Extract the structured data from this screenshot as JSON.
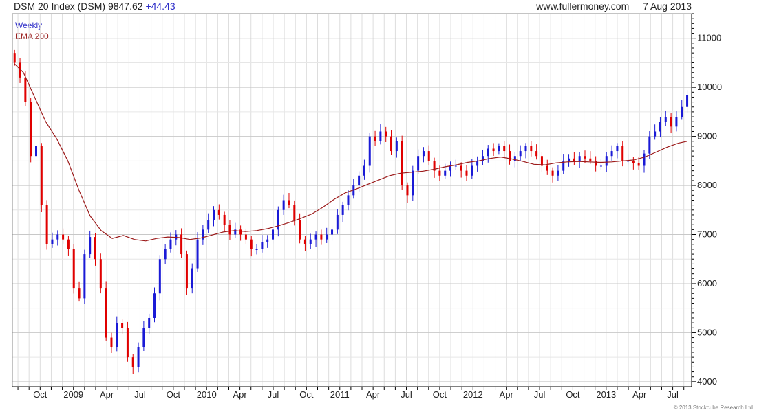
{
  "header": {
    "symbol": "DSM 20 Index (DSM)",
    "last": "9847.62",
    "change": "+44.43",
    "site": "www.fullermoney.com",
    "date": "7 Aug 2013"
  },
  "legend": {
    "weekly": "Weekly",
    "ema": "EMA 200"
  },
  "copyright": "© 2013 Stockcube Research Ltd",
  "colors": {
    "up": "#1a1ad6",
    "down": "#e00000",
    "ema": "#9c1a1a",
    "grid": "#dddddd",
    "axis": "#000000"
  },
  "chart_data": {
    "type": "candlestick",
    "interval": "Weekly",
    "ylim": [
      3900,
      11500
    ],
    "y_ticks": [
      4000,
      5000,
      6000,
      7000,
      8000,
      9000,
      10000,
      11000
    ],
    "x_tick_labels": [
      "Oct",
      "2009",
      "Apr",
      "Jul",
      "Oct",
      "2010",
      "Apr",
      "Jul",
      "Oct",
      "2011",
      "Apr",
      "Jul",
      "Oct",
      "2012",
      "Apr",
      "Jul",
      "Oct",
      "2013",
      "Apr",
      "Jul"
    ],
    "x_tick_months": [
      3,
      6,
      9,
      12,
      15,
      18,
      21,
      24,
      27,
      30,
      33,
      36,
      39,
      42,
      45,
      48,
      51,
      54,
      57,
      60
    ],
    "x_range_months": [
      0.5,
      61.7
    ],
    "close_series_weekly": [
      10500,
      10200,
      9700,
      8600,
      8800,
      7600,
      6800,
      6900,
      7000,
      6900,
      6700,
      5900,
      5700,
      6600,
      6950,
      6500,
      5900,
      4900,
      4700,
      5200,
      5100,
      4500,
      4300,
      4700,
      5100,
      5300,
      5800,
      6500,
      6700,
      6900,
      7000,
      6600,
      5900,
      6300,
      6900,
      7100,
      7300,
      7500,
      7400,
      7200,
      7000,
      7100,
      7000,
      6900,
      6700,
      6700,
      6850,
      6900,
      7100,
      7500,
      7700,
      7600,
      7300,
      6900,
      6800,
      6900,
      7000,
      6900,
      7000,
      7100,
      7400,
      7600,
      7800,
      8000,
      8200,
      8400,
      9000,
      8900,
      9100,
      9000,
      8700,
      8900,
      8000,
      7800,
      8300,
      8600,
      8700,
      8500,
      8300,
      8200,
      8300,
      8400,
      8400,
      8300,
      8200,
      8400,
      8500,
      8600,
      8750,
      8700,
      8800,
      8700,
      8500,
      8600,
      8700,
      8800,
      8700,
      8600,
      8400,
      8300,
      8200,
      8300,
      8500,
      8550,
      8500,
      8600,
      8550,
      8500,
      8400,
      8400,
      8600,
      8700,
      8800,
      8500,
      8500,
      8450,
      8400,
      8650,
      9000,
      9100,
      9300,
      9400,
      9200,
      9400,
      9600,
      9847.62
    ],
    "ema_200": [
      [
        0.7,
        10480
      ],
      [
        1.5,
        10300
      ],
      [
        2.5,
        9800
      ],
      [
        3.5,
        9300
      ],
      [
        4.5,
        8950
      ],
      [
        5.5,
        8500
      ],
      [
        6.5,
        7900
      ],
      [
        7.5,
        7380
      ],
      [
        8.5,
        7080
      ],
      [
        9.5,
        6920
      ],
      [
        10.5,
        6980
      ],
      [
        11.5,
        6900
      ],
      [
        12.5,
        6870
      ],
      [
        13.5,
        6920
      ],
      [
        14.5,
        6950
      ],
      [
        15.5,
        6940
      ],
      [
        16.5,
        6900
      ],
      [
        17.5,
        6930
      ],
      [
        18.5,
        6990
      ],
      [
        19.5,
        7050
      ],
      [
        20.5,
        7080
      ],
      [
        21.5,
        7060
      ],
      [
        22.5,
        7080
      ],
      [
        23.5,
        7120
      ],
      [
        24.5,
        7180
      ],
      [
        25.5,
        7250
      ],
      [
        26.5,
        7330
      ],
      [
        27.5,
        7420
      ],
      [
        28.5,
        7560
      ],
      [
        29.5,
        7720
      ],
      [
        30.5,
        7850
      ],
      [
        31.5,
        7930
      ],
      [
        32.5,
        8020
      ],
      [
        33.5,
        8110
      ],
      [
        34.5,
        8200
      ],
      [
        35.5,
        8250
      ],
      [
        36.5,
        8270
      ],
      [
        37.5,
        8290
      ],
      [
        38.5,
        8330
      ],
      [
        39.5,
        8380
      ],
      [
        40.5,
        8420
      ],
      [
        41.5,
        8470
      ],
      [
        42.5,
        8500
      ],
      [
        43.5,
        8550
      ],
      [
        44.5,
        8580
      ],
      [
        45.5,
        8540
      ],
      [
        46.5,
        8490
      ],
      [
        47.5,
        8430
      ],
      [
        48.5,
        8420
      ],
      [
        49.5,
        8460
      ],
      [
        50.5,
        8480
      ],
      [
        51.5,
        8490
      ],
      [
        52.5,
        8480
      ],
      [
        53.5,
        8470
      ],
      [
        54.5,
        8480
      ],
      [
        55.5,
        8500
      ],
      [
        56.5,
        8520
      ],
      [
        57.5,
        8580
      ],
      [
        58.5,
        8680
      ],
      [
        59.5,
        8780
      ],
      [
        60.5,
        8860
      ],
      [
        61.3,
        8900
      ]
    ]
  }
}
